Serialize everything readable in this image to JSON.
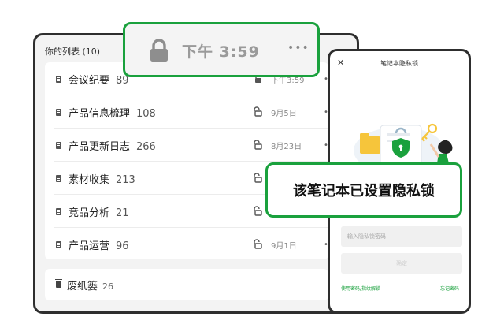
{
  "list": {
    "header": "你的列表 (10)",
    "rows": [
      {
        "name": "会议纪要",
        "count": "89",
        "date": "下午3:59"
      },
      {
        "name": "产品信息梳理",
        "count": "108",
        "date": "9月5日"
      },
      {
        "name": "产品更新日志",
        "count": "266",
        "date": "8月23日"
      },
      {
        "name": "素材收集",
        "count": "213",
        "date": ""
      },
      {
        "name": "竞品分析",
        "count": "21",
        "date": ""
      },
      {
        "name": "产品运营",
        "count": "96",
        "date": "9月1日"
      }
    ],
    "trash": {
      "name": "废纸篓",
      "count": "26"
    }
  },
  "status_bubble": {
    "time": "下午 3:59",
    "more": "•••"
  },
  "lock_screen": {
    "close": "✕",
    "title": "笔记本隐私锁",
    "password_placeholder": "输入隐私锁密码",
    "confirm_label": "确定",
    "link_left": "使用密码/指纹解锁",
    "link_right": "忘记密码"
  },
  "callout": "该笔记本已设置隐私锁",
  "colors": {
    "accent": "#1aa13d",
    "frame": "#2e2e2e",
    "background": "#f3f3f3"
  }
}
